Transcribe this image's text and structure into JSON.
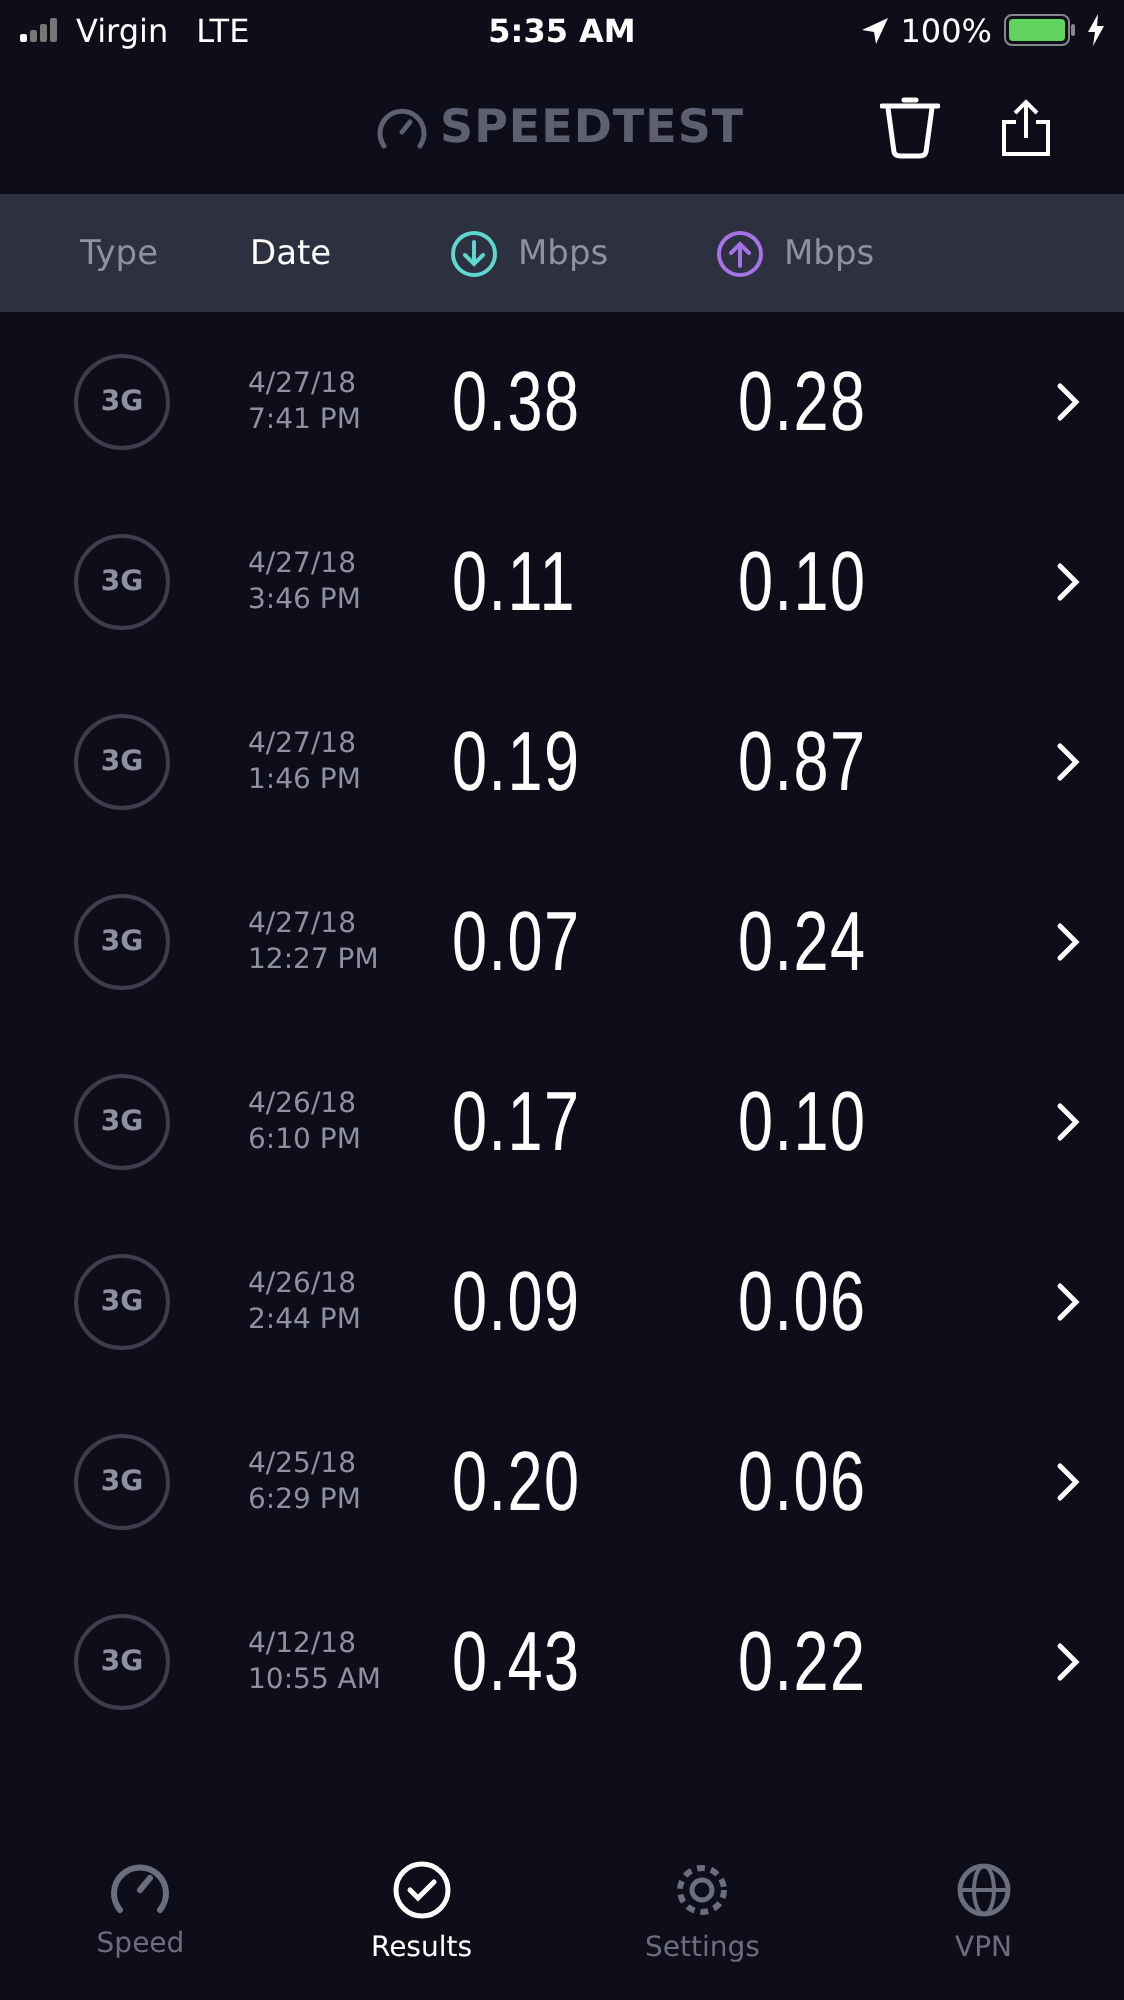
{
  "status_bar": {
    "carrier": "Virgin",
    "network": "LTE",
    "time": "5:35 AM",
    "battery": "100%"
  },
  "header": {
    "title": "SPEEDTEST"
  },
  "columns": [
    {
      "label": "Type",
      "kind": "text",
      "selected": false
    },
    {
      "label": "Date",
      "kind": "text",
      "selected": true
    },
    {
      "label": "Mbps",
      "kind": "download",
      "selected": false
    },
    {
      "label": "Mbps",
      "kind": "upload",
      "selected": false
    }
  ],
  "results": [
    {
      "type": "3G",
      "date": "4/27/18",
      "time": "7:41 PM",
      "download": "0.38",
      "upload": "0.28"
    },
    {
      "type": "3G",
      "date": "4/27/18",
      "time": "3:46 PM",
      "download": "0.11",
      "upload": "0.10"
    },
    {
      "type": "3G",
      "date": "4/27/18",
      "time": "1:46 PM",
      "download": "0.19",
      "upload": "0.87"
    },
    {
      "type": "3G",
      "date": "4/27/18",
      "time": "12:27 PM",
      "download": "0.07",
      "upload": "0.24"
    },
    {
      "type": "3G",
      "date": "4/26/18",
      "time": "6:10 PM",
      "download": "0.17",
      "upload": "0.10"
    },
    {
      "type": "3G",
      "date": "4/26/18",
      "time": "2:44 PM",
      "download": "0.09",
      "upload": "0.06"
    },
    {
      "type": "3G",
      "date": "4/25/18",
      "time": "6:29 PM",
      "download": "0.20",
      "upload": "0.06"
    },
    {
      "type": "3G",
      "date": "4/12/18",
      "time": "10:55 AM",
      "download": "0.43",
      "upload": "0.22"
    }
  ],
  "tabs": [
    {
      "label": "Speed",
      "kind": "speed",
      "selected": false
    },
    {
      "label": "Results",
      "kind": "results",
      "selected": true
    },
    {
      "label": "Settings",
      "kind": "settings",
      "selected": false
    },
    {
      "label": "VPN",
      "kind": "vpn",
      "selected": false
    }
  ]
}
